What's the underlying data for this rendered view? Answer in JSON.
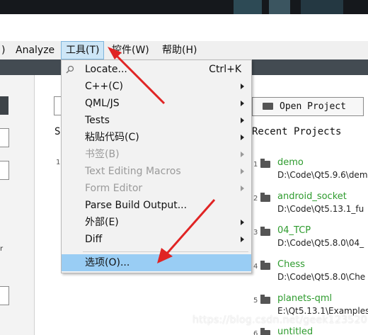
{
  "menubar": {
    "items": [
      {
        "label": ")"
      },
      {
        "label": "Analyze"
      },
      {
        "label": "工具(T)"
      },
      {
        "label": "控件(W)"
      },
      {
        "label": "帮助(H)"
      }
    ]
  },
  "tools_menu": {
    "items": [
      {
        "label": "Locate...",
        "shortcut": "Ctrl+K",
        "icon": "search-icon"
      },
      {
        "label": "C++(C)",
        "submenu": true
      },
      {
        "label": "QML/JS",
        "submenu": true
      },
      {
        "label": "Tests",
        "submenu": true
      },
      {
        "label": "粘贴代码(C)",
        "submenu": true
      },
      {
        "label": "书签(B)",
        "submenu": true,
        "disabled": true
      },
      {
        "label": "Text Editing Macros",
        "submenu": true,
        "disabled": true
      },
      {
        "label": "Form Editor",
        "submenu": true,
        "disabled": true
      },
      {
        "label": "Parse Build Output..."
      },
      {
        "label": "外部(E)",
        "submenu": true
      },
      {
        "label": "Diff",
        "submenu": true
      },
      {
        "label": "选项(O)...",
        "highlighted": true
      }
    ]
  },
  "welcome": {
    "open_project_label": "Open Project",
    "recent_title": "Recent Projects",
    "left_partial_s": "S",
    "left_partial_1": "1",
    "left_partial_r": "r",
    "projects": [
      {
        "num": "1",
        "name": "demo",
        "path": "D:\\Code\\Qt5.9.6\\dem"
      },
      {
        "num": "2",
        "name": "android_socket",
        "path": "D:\\Code\\Qt5.13.1_fu"
      },
      {
        "num": "3",
        "name": "04_TCP",
        "path": "D:\\Code\\Qt5.8.0\\04_"
      },
      {
        "num": "4",
        "name": "Chess",
        "path": "D:\\Code\\Qt5.8.0\\Che"
      },
      {
        "num": "5",
        "name": "planets-qml",
        "path": "E:\\Qt5.13.1\\Examples"
      },
      {
        "num": "6",
        "name": "untitled",
        "path": ""
      }
    ]
  },
  "watermark": "https://blog.csdn.net/geek123520",
  "colors": {
    "highlight": "#99cdf4",
    "project_link": "#2e9b2e",
    "annotation_arrow": "#e02424"
  }
}
